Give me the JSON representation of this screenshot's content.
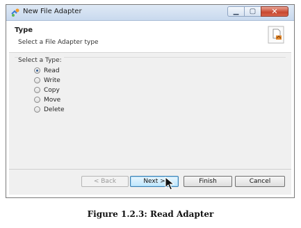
{
  "window": {
    "title": "New File Adapter",
    "controls": {
      "minimize_icon": "minimize-icon",
      "maximize_icon": "maximize-icon",
      "close_icon": "close-icon"
    }
  },
  "header": {
    "title": "Type",
    "description": "Select a File Adapter type",
    "icon": "file-adapter-icon"
  },
  "type_group": {
    "label": "Select a Type:",
    "options": [
      {
        "label": "Read",
        "checked": true
      },
      {
        "label": "Write",
        "checked": false
      },
      {
        "label": "Copy",
        "checked": false
      },
      {
        "label": "Move",
        "checked": false
      },
      {
        "label": "Delete",
        "checked": false
      }
    ]
  },
  "buttons": {
    "back": "< Back",
    "next": "Next >",
    "finish": "Finish",
    "cancel": "Cancel"
  },
  "caption": "Figure 1.2.3: Read Adapter",
  "colors": {
    "titlebar": "#c9d9ee",
    "panel": "#f0f0f0",
    "close_button": "#c8472f",
    "radio_dot": "#2e5a91"
  }
}
